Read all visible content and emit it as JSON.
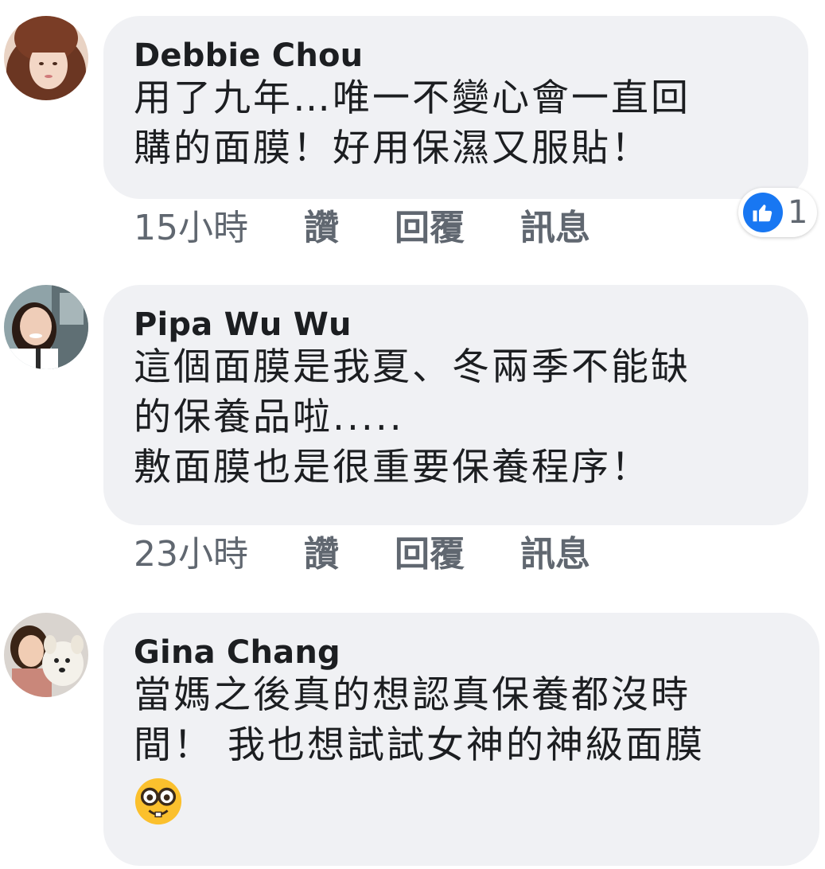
{
  "comments": [
    {
      "author": "Debbie Chou",
      "lines": [
        "用了九年…唯一不變心會一直回",
        "購的面膜！好用保濕又服貼！"
      ],
      "time": "15小時",
      "like_label": "讚",
      "reply_label": "回覆",
      "message_label": "訊息",
      "reaction_count": "1",
      "avatar_icon": "avatar-photo-woman-brown-hair"
    },
    {
      "author": "Pipa Wu Wu",
      "lines": [
        "這個面膜是我夏、冬兩季不能缺",
        "的保養品啦.....",
        "敷面膜也是很重要保養程序！"
      ],
      "time": "23小時",
      "like_label": "讚",
      "reply_label": "回覆",
      "message_label": "訊息",
      "avatar_icon": "avatar-photo-woman-smiling"
    },
    {
      "author": "Gina Chang",
      "lines": [
        "當媽之後真的想認真保養都沒時",
        "間！ 我也想試試女神的神級面膜"
      ],
      "emoji": "nerd-face-emoji",
      "avatar_icon": "avatar-photo-woman-with-dog"
    }
  ],
  "colors": {
    "bubble": "#f0f1f4",
    "meta_text": "#606770",
    "like_blue": "#1877f2"
  }
}
